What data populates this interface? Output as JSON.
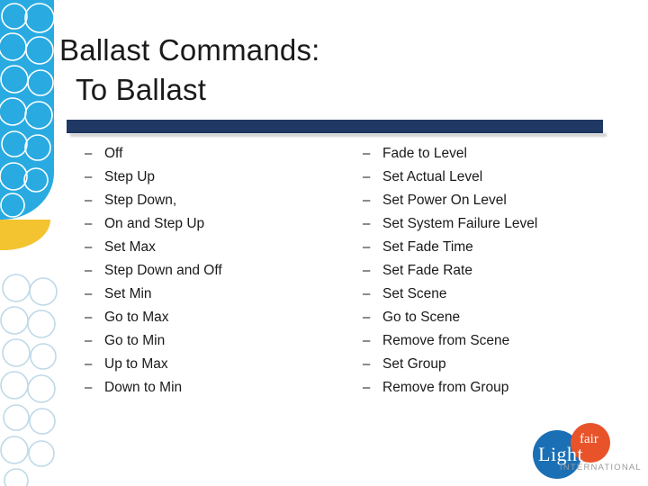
{
  "slide": {
    "title_line1": "Ballast Commands:",
    "title_line2": "To Ballast",
    "bullet_marker": "–",
    "left_column": [
      "Off",
      "Step Up",
      "Step Down,",
      "On and Step Up",
      "Set Max",
      "Step Down and Off",
      "Set Min",
      "Go to Max",
      "Go to Min",
      "Up to Max",
      "Down to Min"
    ],
    "right_column": [
      "Fade to Level",
      "Set Actual Level",
      "Set Power On Level",
      "Set System Failure Level",
      "Set Fade Time",
      "Set Fade Rate",
      "Set Scene",
      "Go to Scene",
      "Remove from Scene",
      "Set Group",
      "Remove from Group"
    ],
    "logo": {
      "word_light": "Light",
      "word_fair": "fair",
      "word_international": "INTERNATIONAL"
    },
    "colors": {
      "band_blue": "#29abe2",
      "band_yellow": "#f4c430",
      "divider": "#1f3864",
      "text": "#1a1a1a",
      "logo_blue": "#1a6fb5",
      "logo_orange": "#e8532a"
    }
  }
}
